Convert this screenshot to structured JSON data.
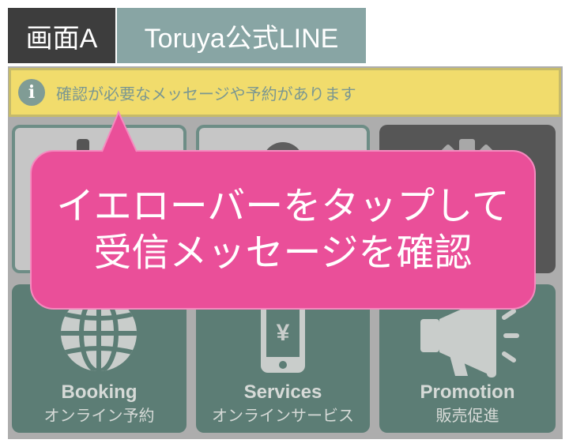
{
  "tabs": {
    "screen_label": "画面A",
    "app_label": "Toruya公式LINE"
  },
  "notice": {
    "icon": "info-icon",
    "icon_glyph": "i",
    "text": "確認が必要なメッセージや予約があります"
  },
  "callout": {
    "lines": [
      "イエローバーをタップして",
      "受信メッセージを確認"
    ]
  },
  "tiles_top": [
    {
      "icon": "calendar-icon"
    },
    {
      "icon": "user-icon"
    },
    {
      "icon": "gear-icon"
    }
  ],
  "tiles_bottom": [
    {
      "icon": "globe-icon",
      "title": "Booking",
      "subtitle": "オンライン予約"
    },
    {
      "icon": "phone-yen-icon",
      "symbol": "¥",
      "title": "Services",
      "subtitle": "オンラインサービス"
    },
    {
      "icon": "megaphone-icon",
      "title": "Promotion",
      "subtitle": "販売促進"
    }
  ],
  "colors": {
    "tab_dark": "#3d3d3d",
    "tab_teal": "#88a5a4",
    "panel": "#adadad",
    "notice_bg": "#f1dc6c",
    "notice_text": "#7b9791",
    "notice_icon": "#809c95",
    "callout": "#ea4f99",
    "tile_light": "#c6c6c6",
    "tile_border": "#6d8d86",
    "tile_dark": "#565656",
    "tile_teal": "#5c7d75",
    "tile_text": "#d6dad7",
    "icon_light": "#c9cdcb"
  }
}
